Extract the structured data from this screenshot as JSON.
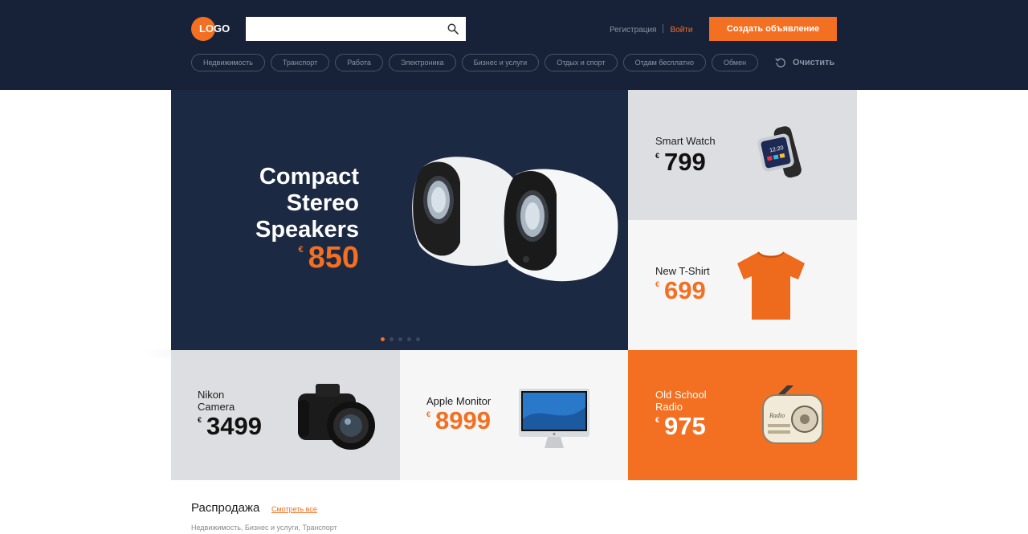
{
  "header": {
    "logo_text": "LOGO",
    "search_placeholder": "",
    "register_label": "Регистрация",
    "login_label": "Войти",
    "create_button_label": "Создать объявление",
    "clear_label": "Очистить",
    "categories": [
      "Недвижимость",
      "Транспорт",
      "Работа",
      "Электроника",
      "Бизнес и услуги",
      "Отдых и спорт",
      "Отдам бесплатно",
      "Обмен"
    ]
  },
  "hero": {
    "title_lines": [
      "Compact",
      "Stereo",
      "Speakers"
    ],
    "currency": "€",
    "price": "850",
    "slides_count": 5,
    "active_slide": 1
  },
  "tiles": {
    "watch": {
      "name": "Smart Watch",
      "currency": "€",
      "price": "799",
      "watch_time": "12:20"
    },
    "shirt": {
      "name": "New T-Shirt",
      "currency": "€",
      "price": "699"
    },
    "camera": {
      "name_line1": "Nikon",
      "name_line2": "Camera",
      "currency": "€",
      "price": "3499"
    },
    "monitor": {
      "name": "Apple Monitor",
      "currency": "€",
      "price": "8999"
    },
    "radio": {
      "name_line1": "Old School",
      "name_line2": "Radio",
      "currency": "€",
      "price": "975",
      "radio_brand": "Radio"
    }
  },
  "sale": {
    "title": "Распродажа",
    "see_all": "Смотреть все",
    "subtitle": "Недвижимость, Бизнес и услуги, Транспорт"
  },
  "colors": {
    "navy": "#172238",
    "hero_bg": "#1c2942",
    "accent": "#f36f21",
    "tile_gray": "#dddee1",
    "tile_light": "#f6f6f6"
  }
}
